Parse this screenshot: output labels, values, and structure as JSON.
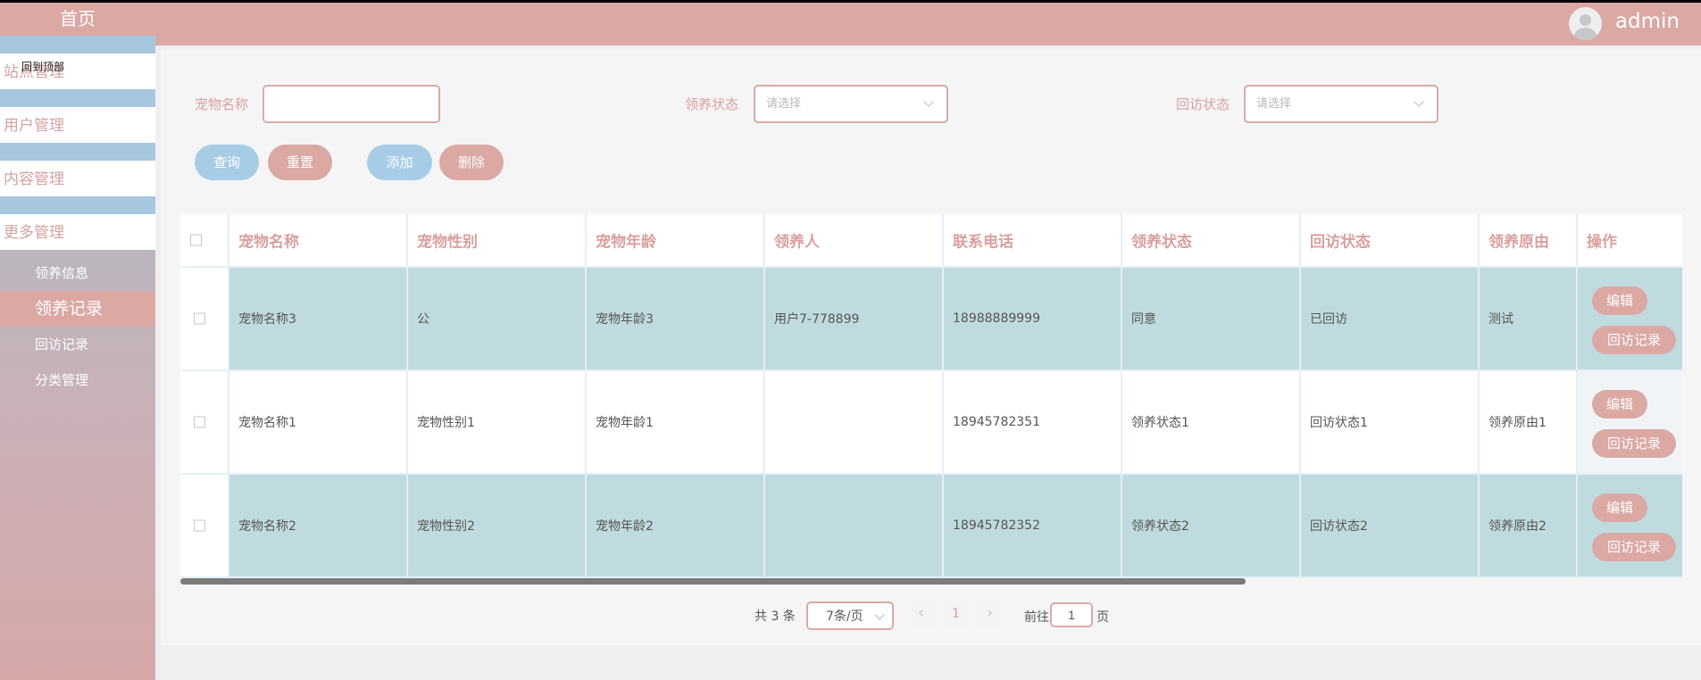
{
  "sidebar": {
    "home": "首页",
    "items": [
      {
        "label": "站点管理",
        "overlay": "回到顶部"
      },
      {
        "label": "用户管理"
      },
      {
        "label": "内容管理"
      },
      {
        "label": "更多管理"
      }
    ],
    "sub_items": [
      {
        "label": "领养信息",
        "active": false
      },
      {
        "label": "领养记录",
        "active": true
      },
      {
        "label": "回访记录",
        "active": false
      },
      {
        "label": "分类管理",
        "active": false
      }
    ]
  },
  "header": {
    "username": "admin"
  },
  "search": {
    "name_label": "宠物名称",
    "name_value": "",
    "adopt_label": "领养状态",
    "adopt_placeholder": "请选择",
    "visit_label": "回访状态",
    "visit_placeholder": "请选择"
  },
  "buttons": {
    "query": "查询",
    "reset": "重置",
    "add": "添加",
    "delete": "删除"
  },
  "table": {
    "headers": [
      "宠物名称",
      "宠物性别",
      "宠物年龄",
      "领养人",
      "联系电话",
      "领养状态",
      "回访状态",
      "领养原由",
      "操作"
    ],
    "rows": [
      [
        "宠物名称3",
        "公",
        "宠物年龄3",
        "用户7-778899",
        "18988889999",
        "同意",
        "已回访",
        "测试"
      ],
      [
        "宠物名称1",
        "宠物性别1",
        "宠物年龄1",
        "",
        "18945782351",
        "领养状态1",
        "回访状态1",
        "领养原由1"
      ],
      [
        "宠物名称2",
        "宠物性别2",
        "宠物年龄2",
        "",
        "18945782352",
        "领养状态2",
        "回访状态2",
        "领养原由2"
      ]
    ],
    "row_actions": {
      "edit": "编辑",
      "visit_record": "回访记录"
    }
  },
  "pagination": {
    "total": "共 3 条",
    "page_size": "7条/页",
    "prev": "‹",
    "current_page": "1",
    "next": "›",
    "goto_prefix": "前往",
    "goto_value": "1",
    "goto_suffix": "页"
  },
  "colors": {
    "brand_pink": "#dba8a4",
    "accent_blue": "#a7cde6",
    "row_highlight": "#c0dbe0",
    "label_pink": "#d9a09f"
  }
}
